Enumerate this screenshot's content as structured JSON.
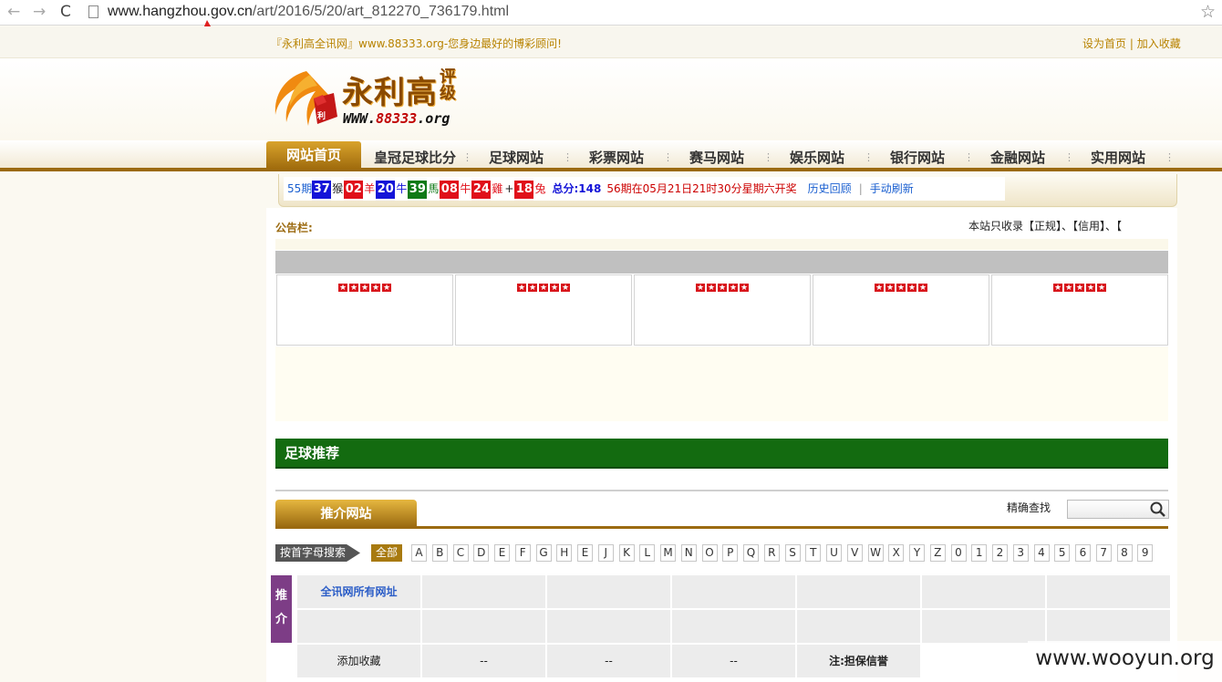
{
  "browser": {
    "back_glyph": "←",
    "forward_glyph": "→",
    "reload_glyph": "C",
    "url_domain": "www.hangzhou.gov.cn",
    "url_path": "/art/2016/5/20/art_812270_736179.html",
    "star_glyph": "☆"
  },
  "site": {
    "slogan": "『永利高全讯网』www.88333.org-您身边最好的博彩顾问!",
    "set_home": "设为首页",
    "divider": " | ",
    "bookmark": "加入收藏",
    "logo_text": "永利高",
    "logo_text_vertical": "评级",
    "logo_url_prefix": "WWW.",
    "logo_url_num": "88333",
    "logo_url_suffix": ".org",
    "logo_die_chars": "利"
  },
  "nav": {
    "home": "网站首页",
    "items": [
      "皇冠足球比分",
      "足球网站",
      "彩票网站",
      "赛马网站",
      "娱乐网站",
      "银行网站",
      "金融网站",
      "实用网站"
    ]
  },
  "lotto": {
    "period": "55期",
    "balls": [
      {
        "num": "37",
        "zodiac": "猴",
        "color": "blue"
      },
      {
        "num": "02",
        "zodiac": "羊",
        "color": "red"
      },
      {
        "num": "20",
        "zodiac": "牛",
        "color": "blue"
      },
      {
        "num": "39",
        "zodiac": "馬",
        "color": "green"
      },
      {
        "num": "08",
        "zodiac": "牛",
        "color": "red"
      },
      {
        "num": "24",
        "zodiac": "雞",
        "color": "red"
      }
    ],
    "plus": "+",
    "special": {
      "num": "18",
      "zodiac": "兔",
      "color": "red"
    },
    "total": "总分:148",
    "next_draw": "56期在05月21日21时30分星期六开奖",
    "history": "历史回顾",
    "sep": "|",
    "refresh": "手动刷新"
  },
  "notice": {
    "label": "公告栏:",
    "text": "本站只收录【正规】、【信用】、【"
  },
  "ad_stars": "★★★★★",
  "sections": {
    "football": "足球推荐",
    "recommend_tab": "推介网站",
    "search_label": "精确查找",
    "search_value": ""
  },
  "alpha": {
    "label": "按首字母搜索",
    "all": "全部",
    "letters": [
      "A",
      "B",
      "C",
      "D",
      "E",
      "F",
      "G",
      "H",
      "E",
      "J",
      "K",
      "L",
      "M",
      "N",
      "O",
      "P",
      "Q",
      "R",
      "S",
      "T",
      "U",
      "V",
      "W",
      "X",
      "Y",
      "Z",
      "0",
      "1",
      "2",
      "3",
      "4",
      "5",
      "6",
      "7",
      "8",
      "9"
    ]
  },
  "table": {
    "side_tag_1": "推",
    "side_tag_2": "介",
    "row1": [
      "全讯网所有网址",
      "",
      "",
      "",
      "",
      ""
    ],
    "row2": [
      "",
      "",
      "",
      "",
      "",
      ""
    ],
    "row3": [
      "添加收藏",
      "--",
      "--",
      "--",
      "注:担保信誉"
    ]
  },
  "watermark": "www.wooyun.org",
  "colors": {
    "accent_gold": "#9b6a10",
    "ball_blue": "#1414d8",
    "ball_red": "#e0101a",
    "ball_green": "#0f7a17",
    "football_green": "#136b10",
    "side_purple": "#7d3d86"
  }
}
